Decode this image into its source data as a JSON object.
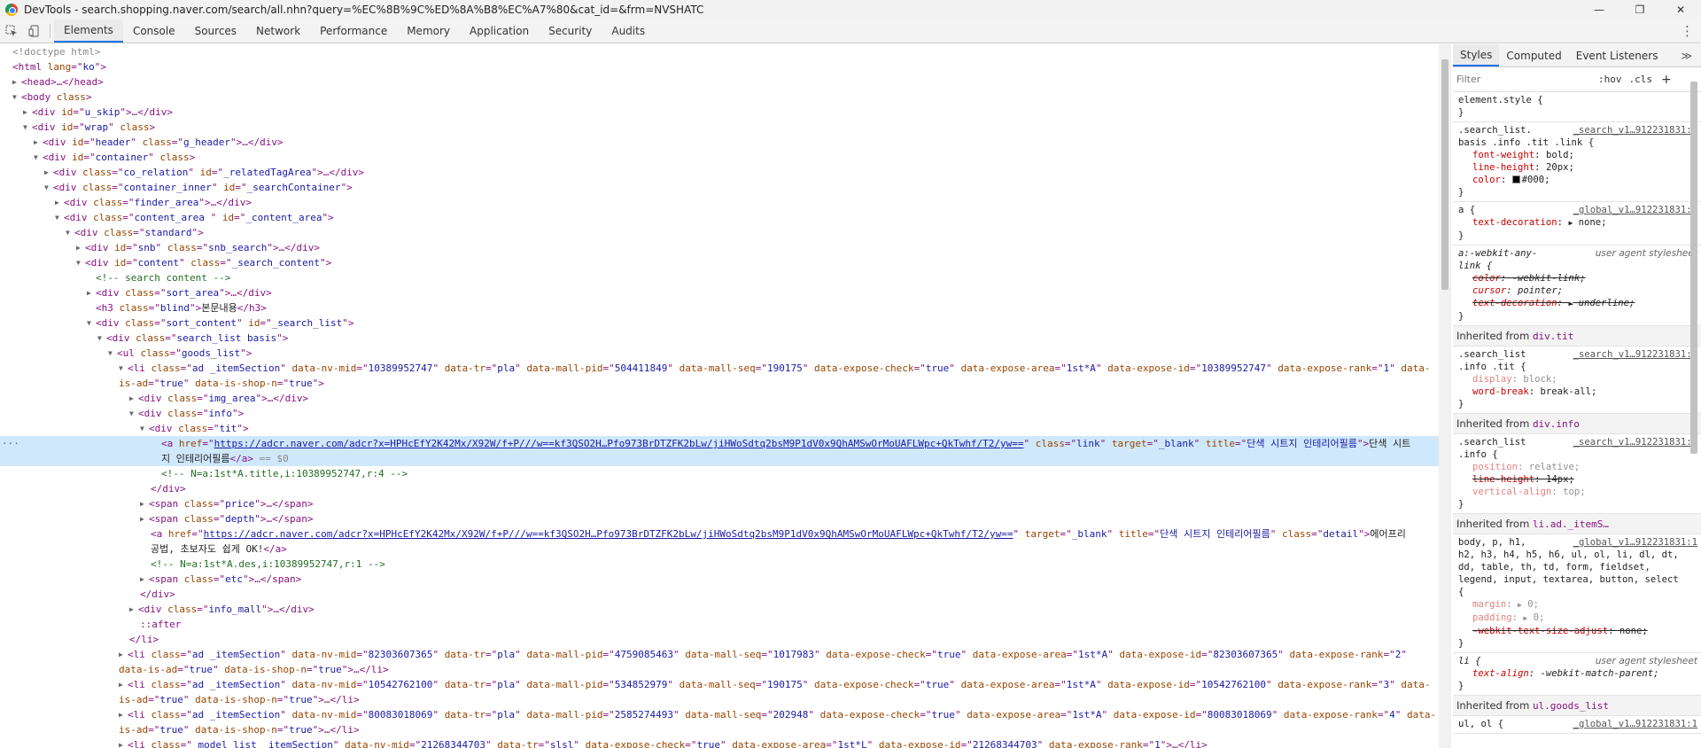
{
  "window": {
    "title": "DevTools - search.shopping.naver.com/search/all.nhn?query=%EC%8B%9C%ED%8A%B8%EC%A7%80&cat_id=&frm=NVSHATC",
    "controls": {
      "minimize": "—",
      "maximize": "❐",
      "close": "✕"
    }
  },
  "toolbar": {
    "inspect_icon": "inspect-icon",
    "device_icon": "device-toggle-icon",
    "tabs": [
      "Elements",
      "Console",
      "Sources",
      "Network",
      "Performance",
      "Memory",
      "Application",
      "Security",
      "Audits"
    ],
    "active_tab": "Elements",
    "more": "⋮"
  },
  "dom": {
    "l01": "<!doctype html>",
    "l02a": "<html ",
    "l02b": "lang",
    "l02c": "=\"",
    "l02d": "ko",
    "l02e": "\">",
    "l03": "<head>…</head>",
    "l04a": "<body ",
    "l04b": "class",
    "l04c": ">",
    "l05a": "<div ",
    "l05b": "id",
    "l05c": "=\"",
    "l05d": "u_skip",
    "l05e": "\">…</div>",
    "l06a": "<div ",
    "l06b": "id",
    "l06d": "wrap",
    "l06f": "class",
    "l06e": ">",
    "l07d": "header",
    "l07g": "g_header",
    "l07e": "\">…</div>",
    "l08d": "container",
    "l09d": "co_relation",
    "l09g": "_relatedTagArea",
    "l10d": "container_inner",
    "l10g": "_searchContainer",
    "l11d": "finder_area",
    "l12d": "content_area ",
    "l12g": "_content_area",
    "l13d": "standard",
    "l14d": "snb",
    "l14g": "snb_search",
    "l15d": "content",
    "l15g": "_search_content",
    "l16": "<!-- search content -->",
    "l17d": "sort_area",
    "l18a": "<h3 ",
    "l18d": "blind",
    "l18t": "본문내용",
    "l18e": "</h3>",
    "l19d": "sort_content",
    "l19g": "_search_list",
    "l20d": "search_list basis",
    "l21a": "<ul ",
    "l21d": "goods_list",
    "li1": {
      "cls": "ad _itemSection",
      "nvmid": "10389952747",
      "tr": "pla",
      "pid": "504411849",
      "seq": "190175",
      "check": "true",
      "area": "1st*A",
      "eid": "10389952747",
      "rank": "1",
      "isad": "true",
      "isshop": "true"
    },
    "l24d": "img_area",
    "l25d": "info",
    "l26d": "tit",
    "href": "https://adcr.naver.com/adcr?x=HPHcEfY2K42Mx/X92W/f+P///w==kf3QSO2H…Pfo973BrDTZFK2bLw/jiHWoSdtq2bsM9P1dV0x9QhAMSwOrMoUAFLWpc+QkTwhf/T2/yw==",
    "l27cls": "link",
    "l27target": "_blank",
    "l27title": "단색 시트지 인테리어필름",
    "l27text": "단색 시트",
    "l27btext": "지 인테리어필름",
    "l27bend": "</a>",
    "l27beq": " == $0",
    "l28": "<!-- N=a:1st*A.title,i:10389952747,r:4 -->",
    "l29": "</div>",
    "l30d": "price",
    "l31d": "depth",
    "l32target": "_blank",
    "l32title": "단색 시트지 인테리어필름",
    "l32cls": "detail",
    "l32text": "에어프리",
    "l32btext": "공법, 초보자도 쉽게 OK!",
    "l32bend": "</a>",
    "l33": "<!-- N=a:1st*A.des,i:10389952747,r:1 -->",
    "l34d": "etc",
    "l35": "</div>",
    "l36d": "info_mall",
    "l37": "::after",
    "l38": "</li>",
    "li2": {
      "cls": "ad _itemSection",
      "nvmid": "82303607365",
      "tr": "pla",
      "pid": "4759085463",
      "seq": "1017983",
      "check": "true",
      "area": "1st*A",
      "eid": "82303607365",
      "rank": "2",
      "isad": "true",
      "isshop": "true"
    },
    "li3": {
      "cls": "ad _itemSection",
      "nvmid": "10542762100",
      "tr": "pla",
      "pid": "534852979",
      "seq": "190175",
      "check": "true",
      "area": "1st*A",
      "eid": "10542762100",
      "rank": "3",
      "isad": "true",
      "isshop": "true"
    },
    "li4": {
      "cls": "ad _itemSection",
      "nvmid": "80083018069",
      "tr": "pla",
      "pid": "2585274493",
      "seq": "202948",
      "check": "true",
      "area": "1st*A",
      "eid": "80083018069",
      "rank": "4",
      "isad": "true",
      "isshop": "true"
    },
    "li5": {
      "cls": "_model_list _itemSection",
      "nvmid": "21268344703",
      "tr": "slsl",
      "check": "true",
      "area": "1st*L",
      "eid": "21268344703",
      "rank": "1"
    }
  },
  "styles": {
    "tabs": [
      "Styles",
      "Computed",
      "Event Listeners"
    ],
    "active_tab": "Styles",
    "more": "≫",
    "filter_placeholder": "Filter",
    "hov": ":hov",
    "cls": ".cls",
    "add": "+",
    "r0_sel": "element.style {",
    "r0_close": "}",
    "r1_sel1": ".search_list.",
    "r1_sel2": "basis .info .tit .link {",
    "r1_src": "_search_v1…912231831:1",
    "r1_p1n": "font-weight",
    "r1_p1v": "bold;",
    "r1_p2n": "line-height",
    "r1_p2v": "20px;",
    "r1_p3n": "color",
    "r1_p3v": "#000;",
    "r2_sel": "a {",
    "r2_src": "_global_v1…912231831:1",
    "r2_p1n": "text-decoration",
    "r2_p1v": "none;",
    "r3_sel1": "a:-webkit-any-",
    "r3_sel2": "link {",
    "r3_src": "user agent stylesheet",
    "r3_p1n": "color",
    "r3_p1v": "-webkit-link;",
    "r3_p2n": "cursor",
    "r3_p2v": "pointer;",
    "r3_p3n": "text-decoration",
    "r3_p3v": "underline;",
    "inh1_label": "Inherited from ",
    "inh1_from": "div.tit",
    "r4_sel1": ".search_list",
    "r4_sel2": ".info .tit {",
    "r4_src": "_search_v1…912231831:1",
    "r4_p1n": "display",
    "r4_p1v": "block;",
    "r4_p2n": "word-break",
    "r4_p2v": "break-all;",
    "inh2_label": "Inherited from ",
    "inh2_from": "div.info",
    "r5_sel1": ".search_list",
    "r5_sel2": ".info {",
    "r5_src": "_search_v1…912231831:1",
    "r5_p1n": "position",
    "r5_p1v": "relative;",
    "r5_p2n": "line-height",
    "r5_p2v": "14px;",
    "r5_p3n": "vertical-align",
    "r5_p3v": "top;",
    "inh3_label": "Inherited from ",
    "inh3_from": "li.ad._itemS…",
    "r6_sel1": "body, p, h1,",
    "r6_src": "_global_v1…912231831:1",
    "r6_sel2": "h2, h3, h4, h5, h6, ul, ol, li, dl, dt,",
    "r6_sel3": "dd, table, th, td, form, fieldset,",
    "r6_sel4": "legend, input, textarea, button, select",
    "r6_sel5": "{",
    "r6_p1n": "margin",
    "r6_p1v": "0;",
    "r6_p2n": "padding",
    "r6_p2v": "0;",
    "r6_p3n": "-webkit-text-size-adjust",
    "r6_p3v": "none;",
    "r7_sel": "li {",
    "r7_src": "user agent stylesheet",
    "r7_p1n": "text-align",
    "r7_p1v": "-webkit-match-parent;",
    "inh4_label": "Inherited from ",
    "inh4_from": "ul.goods_list",
    "r8_sel": "ul, ol {",
    "r8_src": "_global_v1…912231831:1"
  }
}
